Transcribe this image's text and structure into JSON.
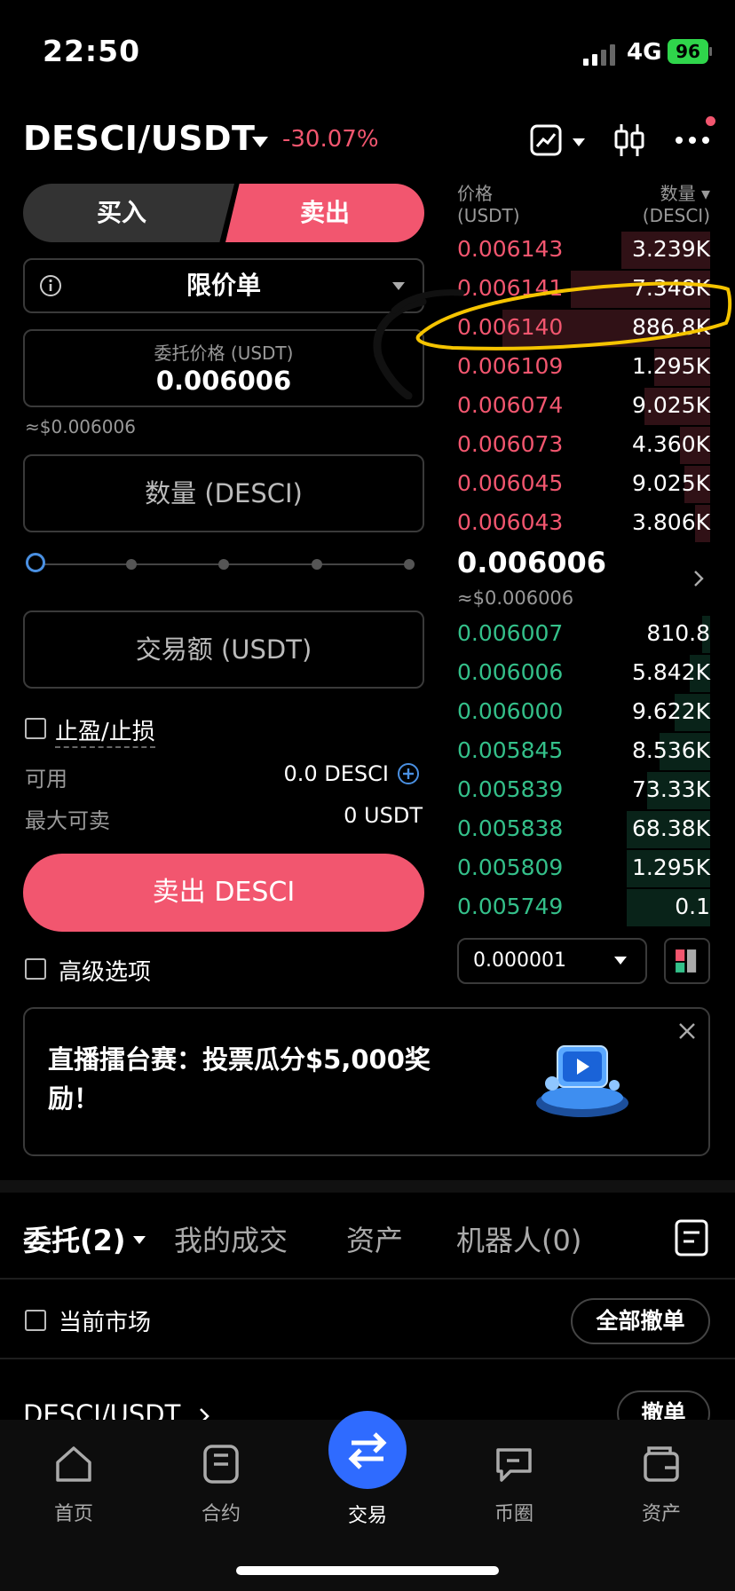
{
  "status_bar": {
    "time": "22:50",
    "network": "4G",
    "battery": "96"
  },
  "header": {
    "pair": "DESCI/USDT",
    "change": "-30.07%"
  },
  "trade_form": {
    "buy_label": "买入",
    "sell_label": "卖出",
    "order_type": "限价单",
    "price_label": "委托价格 (USDT)",
    "price_value": "0.006006",
    "price_approx": "≈$0.006006",
    "quantity_placeholder": "数量 (DESCI)",
    "amount_placeholder": "交易额 (USDT)",
    "tpsl_label": "止盈/止损",
    "available_label": "可用",
    "available_value": "0.0 DESCI",
    "max_sell_label": "最大可卖",
    "max_sell_value": "0 USDT",
    "submit_label": "卖出 DESCI",
    "advanced_label": "高级选项"
  },
  "orderbook": {
    "price_header": "价格",
    "price_unit": "(USDT)",
    "qty_header": "数量 ▾",
    "qty_unit": "(DESCI)",
    "asks": [
      {
        "price": "0.006143",
        "qty": "3.239K",
        "depth": 0.35
      },
      {
        "price": "0.006141",
        "qty": "7.348K",
        "depth": 0.55
      },
      {
        "price": "0.006140",
        "qty": "886.8K",
        "depth": 0.82
      },
      {
        "price": "0.006109",
        "qty": "1.295K",
        "depth": 0.22
      },
      {
        "price": "0.006074",
        "qty": "9.025K",
        "depth": 0.26
      },
      {
        "price": "0.006073",
        "qty": "4.360K",
        "depth": 0.12
      },
      {
        "price": "0.006045",
        "qty": "9.025K",
        "depth": 0.1
      },
      {
        "price": "0.006043",
        "qty": "3.806K",
        "depth": 0.06
      }
    ],
    "last_price": "0.006006",
    "last_price_approx": "≈$0.006006",
    "bids": [
      {
        "price": "0.006007",
        "qty": "810.8",
        "depth": 0.03
      },
      {
        "price": "0.006006",
        "qty": "5.842K",
        "depth": 0.08
      },
      {
        "price": "0.006000",
        "qty": "9.622K",
        "depth": 0.14
      },
      {
        "price": "0.005845",
        "qty": "8.536K",
        "depth": 0.2
      },
      {
        "price": "0.005839",
        "qty": "73.33K",
        "depth": 0.25
      },
      {
        "price": "0.005838",
        "qty": "68.38K",
        "depth": 0.33
      },
      {
        "price": "0.005809",
        "qty": "1.295K",
        "depth": 0.33
      },
      {
        "price": "0.005749",
        "qty": "0.1",
        "depth": 0.33
      }
    ],
    "tick_size": "0.000001"
  },
  "banner": {
    "text": "直播擂台赛：投票瓜分$5,000奖励！"
  },
  "orders_tabs": {
    "tabs": [
      "委托(2)",
      "我的成交",
      "资产",
      "机器人(0)"
    ],
    "current_market_label": "当前市场",
    "cancel_all_label": "全部撤单",
    "order_pair": "DESCI/USDT",
    "cancel_label": "撤单"
  },
  "bottom_nav": {
    "items": [
      "首页",
      "合约",
      "交易",
      "币圈",
      "资产"
    ]
  },
  "colors": {
    "ask": "#f2566f",
    "bid": "#34c08a",
    "accent": "#2f6bff",
    "annotation": "#f5c400"
  }
}
